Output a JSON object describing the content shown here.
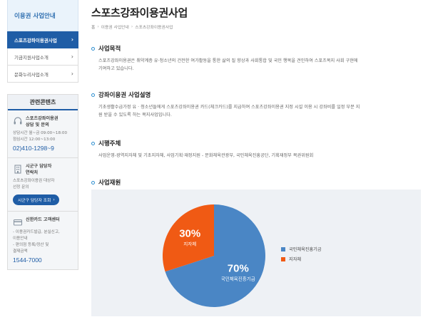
{
  "sidebar": {
    "heading": "이용권 사업안내",
    "items": [
      {
        "label": "스포츠강좌이용권사업",
        "active": true
      },
      {
        "label": "기금지원사업소개",
        "active": false
      },
      {
        "label": "문화누리사업소개",
        "active": false
      }
    ],
    "related": {
      "title": "관련콘텐츠",
      "blocks": [
        {
          "icon": "headset-icon",
          "name_line1": "스포츠강좌이용권",
          "name_line2": "상담 및 문의",
          "text_line1": "상담시간 월~금 09:00~18:00",
          "text_line2": "점심시간 12:00~13:00",
          "phone": "02)410-1298~9"
        },
        {
          "icon": "building-icon",
          "name_line1": "시군구 담당자",
          "name_line2": "연락처",
          "text_line1": "스포츠강좌이용권 대상자",
          "text_line2": "선정 문의",
          "button": "시군구 담당자 조회"
        },
        {
          "icon": "card-icon",
          "name_line1": "신한카드 고객센터",
          "text_line1": "- 이용권카드발급, 분실신고,",
          "text_line2": "이용안내",
          "text_line3": "- 편의점 등록/정산 및",
          "text_line4": "결제금액",
          "phone": "1544-7000"
        }
      ]
    }
  },
  "main": {
    "title": "스포츠강좌이용권사업",
    "breadcrumb": [
      "홈",
      "이용권 사업안내",
      "스포츠강좌이용권사업"
    ],
    "sections": {
      "purpose": {
        "title": "사업목적",
        "line1": "스포츠강좌이용권은 취약계층 유·청소년의 건전한 여가활동을 통한 삶의 질 향상과 사회통합 및 국민 행복을 견인하여 스포츠복지 사회 구현에",
        "line2": "기여하고 있습니다."
      },
      "description": {
        "title": "강좌이용권 사업설명",
        "line1": "기초생활수급가정 유 · 청소년들에게 스포츠강좌이용권 카드(체크카드)를 지급하여 스포츠강좌이용권 지정 시설 이용 시 강좌비를 일정 부분 지",
        "line2": "원 받을 수 있도록 하는 복지사업입니다."
      },
      "agency": {
        "title": "시행주체",
        "line1": "사업운영-광역지자체 및 기초지자체, 사업기획·재정지원 - 문화체육관광부, 국민체육진흥공단, 기획재정부 복권위원회"
      },
      "funding": {
        "title": "사업재원"
      }
    }
  },
  "chart_data": {
    "type": "pie",
    "slices": [
      {
        "label": "국민체육진흥기금",
        "value": 70,
        "display": "70%",
        "color": "#4a86c5"
      },
      {
        "label": "지자체",
        "value": 30,
        "display": "30%",
        "color": "#f05a14"
      }
    ],
    "legend_position": "right"
  }
}
